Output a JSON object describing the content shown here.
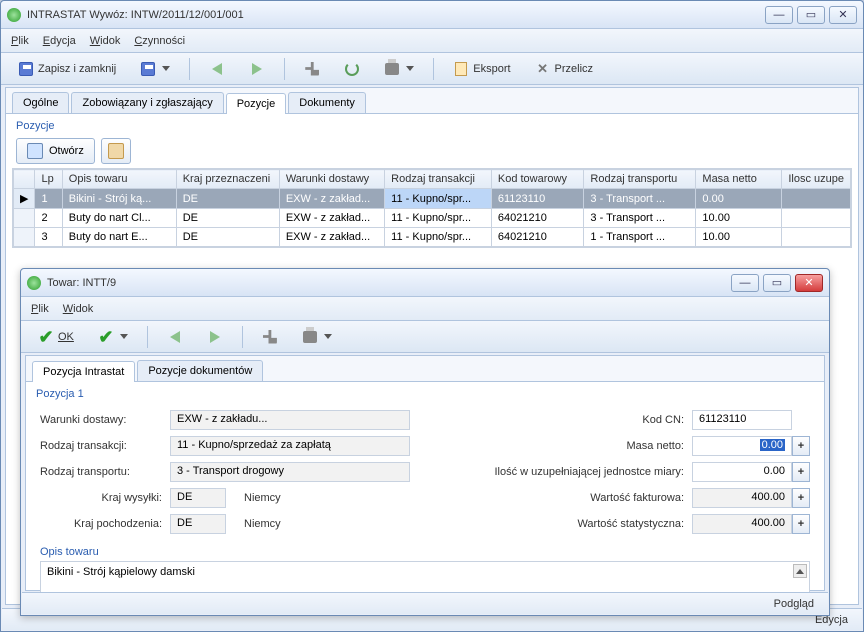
{
  "main": {
    "title": "INTRASTAT Wywóz: INTW/2011/12/001/001",
    "menubar": [
      "Plik",
      "Edycja",
      "Widok",
      "Czynności"
    ],
    "toolbar": {
      "save_close": "Zapisz i zamknij",
      "eksport": "Eksport",
      "przelicz": "Przelicz"
    },
    "tabs": [
      "Ogólne",
      "Zobowiązany i zgłaszający",
      "Pozycje",
      "Dokumenty"
    ],
    "active_tab": 2,
    "section_label": "Pozycje",
    "grid_btn_open": "Otwórz",
    "columns": [
      "Lp",
      "Opis towaru",
      "Kraj przeznaczeni",
      "Warunki dostawy",
      "Rodzaj transakcji",
      "Kod towarowy",
      "Rodzaj transportu",
      "Masa netto",
      "Ilosc uzupe"
    ],
    "rows": [
      {
        "lp": "1",
        "opis": "Bikini - Strój ką...",
        "kraj": "DE",
        "war": "EXW - z zakład...",
        "rodz": "11 - Kupno/spr...",
        "kod": "61123110",
        "trans": "3 - Transport ...",
        "masa": "0.00",
        "ilosc": ""
      },
      {
        "lp": "2",
        "opis": "Buty do nart Cl...",
        "kraj": "DE",
        "war": "EXW - z zakład...",
        "rodz": "11 - Kupno/spr...",
        "kod": "64021210",
        "trans": "3 - Transport ...",
        "masa": "10.00",
        "ilosc": ""
      },
      {
        "lp": "3",
        "opis": "Buty do nart E...",
        "kraj": "DE",
        "war": "EXW - z zakład...",
        "rodz": "11 - Kupno/spr...",
        "kod": "64021210",
        "trans": "1 - Transport ...",
        "masa": "10.00",
        "ilosc": ""
      }
    ],
    "status_right": "Edycja"
  },
  "sub": {
    "title": "Towar: INTT/9",
    "menubar": [
      "Plik",
      "Widok"
    ],
    "ok_label": "OK",
    "tabs": [
      "Pozycja Intrastat",
      "Pozycje dokumentów"
    ],
    "section_label": "Pozycja 1",
    "labels": {
      "warunki": "Warunki dostawy:",
      "rodzaj_trans": "Rodzaj transakcji:",
      "rodzaj_transportu": "Rodzaj transportu:",
      "kraj_wysylki": "Kraj wysyłki:",
      "kraj_pochodzenia": "Kraj pochodzenia:",
      "kod_cn": "Kod CN:",
      "masa": "Masa netto:",
      "ilosc": "Ilość w uzupełniającej jednostce miary:",
      "faktur": "Wartość fakturowa:",
      "stat": "Wartość statystyczna:",
      "opis": "Opis towaru"
    },
    "values": {
      "warunki": "EXW - z zakładu...",
      "rodzaj_trans": "11 - Kupno/sprzedaż za zapłatą",
      "rodzaj_transportu": "3 - Transport drogowy",
      "kraj_wysylki_code": "DE",
      "kraj_wysylki_name": "Niemcy",
      "kraj_pochodzenia_code": "DE",
      "kraj_pochodzenia_name": "Niemcy",
      "kod_cn": "61123110",
      "masa": "0.00",
      "ilosc": "0.00",
      "faktur": "400.00",
      "stat": "400.00",
      "opis_text": "Bikini - Strój kąpielowy damski"
    },
    "status_right": "Podgląd"
  }
}
